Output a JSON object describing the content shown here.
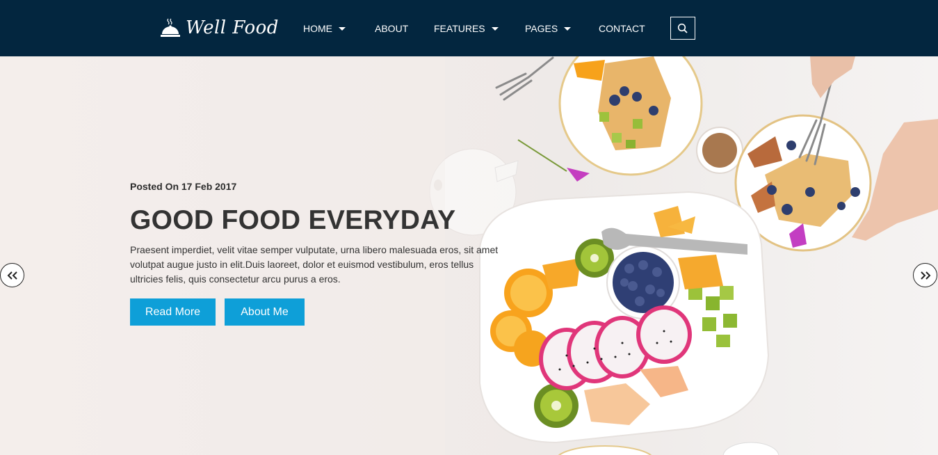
{
  "brand": {
    "name": "Well Food",
    "icon": "cloche-icon"
  },
  "nav": {
    "items": [
      {
        "label": "HOME",
        "dropdown": true
      },
      {
        "label": "ABOUT",
        "dropdown": false
      },
      {
        "label": "FEATURES",
        "dropdown": true
      },
      {
        "label": "PAGES",
        "dropdown": true
      },
      {
        "label": "CONTACT",
        "dropdown": false
      }
    ],
    "search_icon": "search-icon"
  },
  "hero": {
    "posted": "Posted On 17 Feb 2017",
    "title": "GOOD FOOD EVERYDAY",
    "description": "Praesent imperdiet, velit vitae semper vulputate, urna libero malesuada eros, sit amet volutpat augue justo in elit.Duis laoreet, dolor et euismod vestibulum, eros tellus ultricies felis, quis consectetur arcu purus a eros.",
    "buttons": {
      "read_more": "Read More",
      "about_me": "About Me"
    },
    "prev_icon": "double-chevron-left-icon",
    "next_icon": "double-chevron-right-icon"
  },
  "colors": {
    "header_bg": "#03263f",
    "accent": "#0e9fd8",
    "text": "#333333"
  }
}
